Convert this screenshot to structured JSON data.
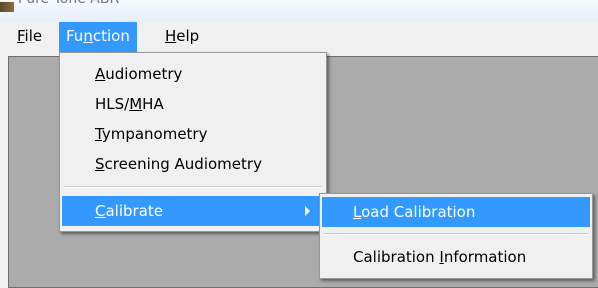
{
  "window": {
    "title": "Pure Tone ABR"
  },
  "menubar": [
    {
      "pre": "",
      "key": "F",
      "post": "ile"
    },
    {
      "pre": "Fu",
      "key": "n",
      "post": "ction"
    },
    {
      "pre": "",
      "key": "H",
      "post": "elp"
    }
  ],
  "function_menu": {
    "items": [
      {
        "pre": "",
        "key": "A",
        "post": "udiometry"
      },
      {
        "pre": "HLS/",
        "key": "M",
        "post": "HA"
      },
      {
        "pre": "",
        "key": "T",
        "post": "ympanometry"
      },
      {
        "pre": "",
        "key": "S",
        "post": "creening Audiometry"
      }
    ],
    "calibrate": {
      "pre": "",
      "key": "C",
      "post": "alibrate"
    }
  },
  "calibrate_submenu": {
    "items": [
      {
        "pre": "",
        "key": "L",
        "post": "oad Calibration"
      },
      {
        "pre": "Calibration ",
        "key": "I",
        "post": "nformation"
      }
    ]
  },
  "colors": {
    "highlight": "#3399ff",
    "menu_bg": "#f0f0f0",
    "workarea": "#ababab"
  }
}
